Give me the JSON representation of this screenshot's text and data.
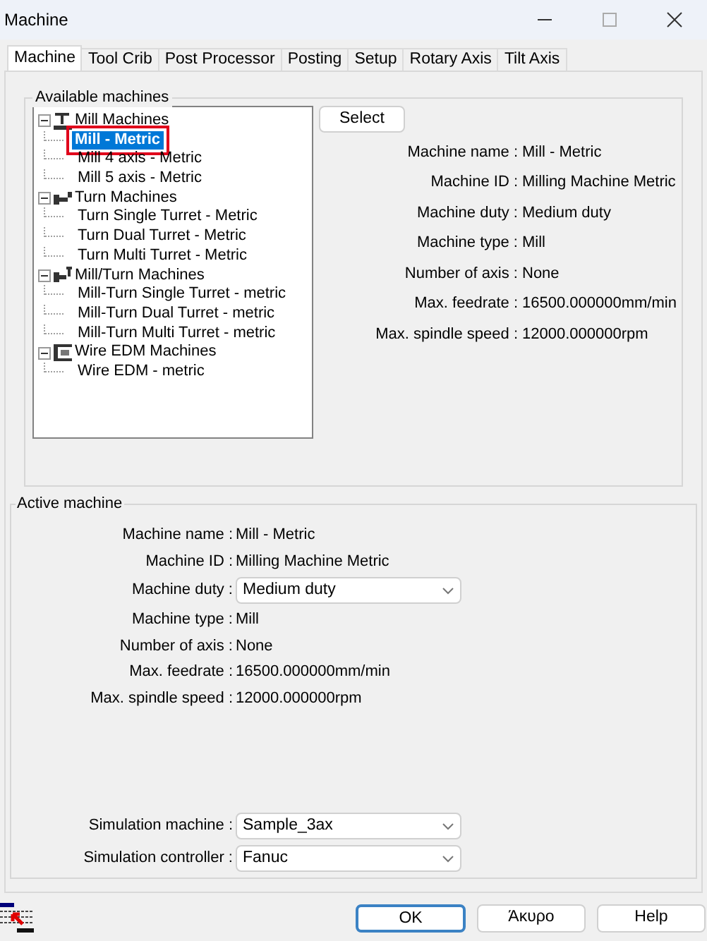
{
  "window": {
    "title": "Machine"
  },
  "tabs": [
    {
      "label": "Machine",
      "selected": true
    },
    {
      "label": "Tool Crib",
      "selected": false
    },
    {
      "label": "Post Processor",
      "selected": false
    },
    {
      "label": "Posting",
      "selected": false
    },
    {
      "label": "Setup",
      "selected": false
    },
    {
      "label": "Rotary Axis",
      "selected": false
    },
    {
      "label": "Tilt Axis",
      "selected": false
    }
  ],
  "available_machines": {
    "title": "Available machines",
    "tree": [
      {
        "label": "Mill Machines",
        "kind": "mill",
        "expanded": true,
        "children": [
          {
            "label": "Mill - Metric",
            "selected": true
          },
          {
            "label": "Mill 4 axis - Metric",
            "selected": false
          },
          {
            "label": "Mill 5 axis - Metric",
            "selected": false
          }
        ]
      },
      {
        "label": "Turn Machines",
        "kind": "turn",
        "expanded": true,
        "children": [
          {
            "label": "Turn Single Turret - Metric",
            "selected": false
          },
          {
            "label": "Turn Dual Turret - Metric",
            "selected": false
          },
          {
            "label": "Turn Multi Turret - Metric",
            "selected": false
          }
        ]
      },
      {
        "label": "Mill/Turn Machines",
        "kind": "millturn",
        "expanded": true,
        "children": [
          {
            "label": "Mill-Turn Single Turret - metric",
            "selected": false
          },
          {
            "label": "Mill-Turn Dual Turret - metric",
            "selected": false
          },
          {
            "label": "Mill-Turn Multi Turret - metric",
            "selected": false
          }
        ]
      },
      {
        "label": "Wire EDM Machines",
        "kind": "wire",
        "expanded": true,
        "children": [
          {
            "label": "Wire EDM - metric",
            "selected": false
          }
        ]
      }
    ],
    "select_button": "Select",
    "details": [
      {
        "label": "Machine name :",
        "value": "Mill - Metric"
      },
      {
        "label": "Machine ID :",
        "value": "Milling Machine Metric"
      },
      {
        "label": "Machine duty :",
        "value": "Medium duty"
      },
      {
        "label": "Machine type :",
        "value": "Mill"
      },
      {
        "label": "Number of axis :",
        "value": "None"
      },
      {
        "label": "Max. feedrate :",
        "value": "16500.000000mm/min"
      },
      {
        "label": "Max. spindle speed :",
        "value": "12000.000000rpm"
      }
    ]
  },
  "active_machine": {
    "title": "Active machine",
    "fields": [
      {
        "label": "Machine name :",
        "value": "Mill - Metric",
        "kind": "text"
      },
      {
        "label": "Machine ID :",
        "value": "Milling Machine Metric",
        "kind": "text"
      },
      {
        "label": "Machine duty :",
        "value": "Medium duty",
        "kind": "dropdown"
      },
      {
        "label": "Machine type :",
        "value": "Mill",
        "kind": "text"
      },
      {
        "label": "Number of axis :",
        "value": "None",
        "kind": "text"
      },
      {
        "label": "Max. feedrate :",
        "value": "16500.000000mm/min",
        "kind": "text"
      },
      {
        "label": "Max. spindle speed :",
        "value": "12000.000000rpm",
        "kind": "text"
      }
    ],
    "simulation": [
      {
        "label": "Simulation machine :",
        "value": "Sample_3ax",
        "kind": "dropdown"
      },
      {
        "label": "Simulation controller :",
        "value": "Fanuc",
        "kind": "dropdown"
      }
    ]
  },
  "buttons": [
    {
      "label": "OK",
      "default": true
    },
    {
      "label": "Άκυρο",
      "default": false
    },
    {
      "label": "Help",
      "default": false
    }
  ]
}
